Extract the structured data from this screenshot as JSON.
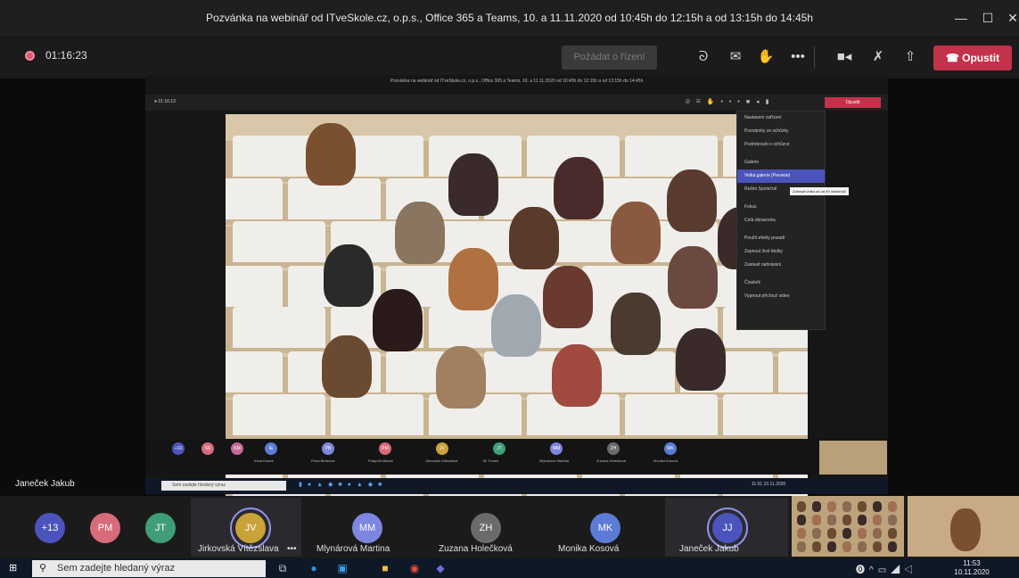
{
  "window": {
    "title": "Pozvánka na webinář od ITveSkole.cz, o.p.s., Office 365 a Teams, 10. a 11.11.2020 od 10:45h do 12:15h a od 13:15h do 14:45h",
    "minimize": "—",
    "maximize": "☐",
    "close": "✕"
  },
  "meeting": {
    "timer": "01:16:23",
    "request_control": "Požádat o řízení",
    "leave": "Opustit",
    "icons": [
      "people-icon",
      "chat-icon",
      "raise-hand-icon",
      "more-icon",
      "camera-icon",
      "mic-icon",
      "share-icon"
    ],
    "icon_glyphs": [
      "ᘐ",
      "✉",
      "✋",
      "•••",
      "■◂",
      "✗",
      "⇧"
    ]
  },
  "inner": {
    "title": "Pozvánka na webinář od ITveSkole.cz, o.p.s., Office 365 a Teams, 10. a 11.11.2020 od 10:45h do 12:15h a od 13:15h do 14:45h",
    "timer": "01:16:13",
    "leave": "Opustit",
    "menu_items": [
      "Nastavení zařízení",
      "Poznámky ze schůzky",
      "Podrobnosti o schůzce",
      "Galerie",
      "Velká galerie (Preview)",
      "Režim Společně",
      "Fokus",
      "Celá obrazovka",
      "Použít efekty pozadí",
      "Zapnout živé titulky",
      "Zastavit nahrávání",
      "Číselník",
      "Vypnout příchozí video"
    ],
    "selected_menu_index": 4,
    "tooltip": "Zobrazit video až od 49 účastníků",
    "strip_avatars": [
      {
        "initials": "+10",
        "color": "#4b53bc",
        "name": ""
      },
      {
        "initials": "SR",
        "color": "#d86b7a",
        "name": ""
      },
      {
        "initials": "KM",
        "color": "#c46a9a",
        "name": ""
      },
      {
        "initials": "IE",
        "color": "#5b7bd5",
        "name": "Irena Dosek"
      },
      {
        "initials": "PB",
        "color": "#7d86e0",
        "name": "Petra Bednová"
      },
      {
        "initials": "PM",
        "color": "#d86b7a",
        "name": "Podpořit Marcel"
      },
      {
        "initials": "JV",
        "color": "#c9a23a",
        "name": "Jirkovská Vítězslava"
      },
      {
        "initials": "JT",
        "color": "#3f9e78",
        "name": "Jiří Tomeš"
      },
      {
        "initials": "MM",
        "color": "#7d86e0",
        "name": "Mlynárová Martina"
      },
      {
        "initials": "ZH",
        "color": "#6b6b6b",
        "name": "Zuzana Holečková"
      },
      {
        "initials": "MK",
        "color": "#5b7bd5",
        "name": "Monika Kosová"
      }
    ],
    "taskbar_search": "Sem zadejte hledaný výraz",
    "clock_time": "11:51",
    "clock_date": "10.11.2020"
  },
  "presenter": "Janeček Jakub",
  "participants": [
    {
      "initials": "+13",
      "color": "#4b53bc",
      "name": ""
    },
    {
      "initials": "PM",
      "color": "#d86b7a",
      "name": ""
    },
    {
      "initials": "JT",
      "color": "#3f9e78",
      "name": ""
    },
    {
      "initials": "JV",
      "color": "#c9a23a",
      "name": "Jirkovská Vítězslava"
    },
    {
      "initials": "MM",
      "color": "#7d86e0",
      "name": "Mlynárová Martina"
    },
    {
      "initials": "ZH",
      "color": "#6b6b6b",
      "name": "Zuzana Holečková"
    },
    {
      "initials": "MK",
      "color": "#5b7bd5",
      "name": "Monika Kosová"
    },
    {
      "initials": "JJ",
      "color": "#4b53bc",
      "name": "Janeček Jakub"
    }
  ],
  "more_label": "•••",
  "taskbar": {
    "search_placeholder": "Sem zadejte hledaný výraz",
    "time": "11:53",
    "date": "10.11.2020"
  }
}
